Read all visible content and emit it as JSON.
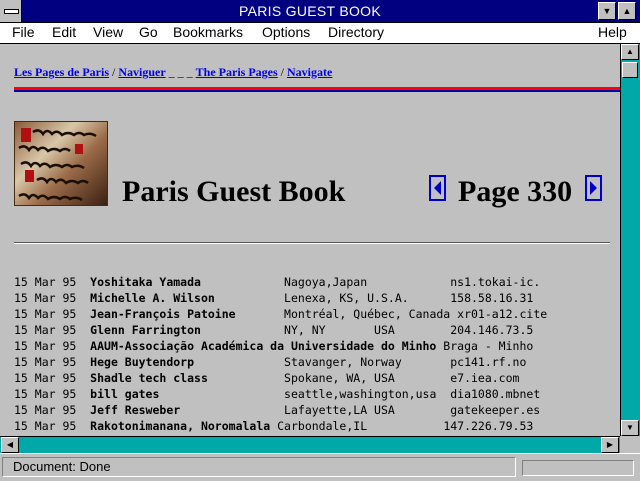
{
  "window": {
    "title": "PARIS GUEST BOOK"
  },
  "menu": [
    "File",
    "Edit",
    "View",
    "Go",
    "Bookmarks",
    "Options",
    "Directory",
    "Help"
  ],
  "breadcrumb": {
    "link1": "Les Pages de Paris",
    "sep1": " / ",
    "link2": "Naviguer",
    "sep2": " _ _ _ ",
    "link3": "The Paris Pages",
    "sep3": " / ",
    "link4": "Navigate"
  },
  "heading": {
    "title": "Paris Guest Book",
    "page": "Page 330"
  },
  "icons": {
    "prev": "left-arrow-icon",
    "next": "right-arrow-icon",
    "logo": "manuscript-logo",
    "scroll_up": "up-arrow-icon",
    "scroll_down": "down-arrow-icon",
    "scroll_left": "left-arrow-icon",
    "scroll_right": "right-arrow-icon"
  },
  "entries": [
    {
      "date": "15 Mar 95",
      "name": "Yoshitaka Yamada",
      "location": "Nagoya,Japan",
      "host": "ns1.tokai-ic."
    },
    {
      "date": "15 Mar 95",
      "name": "Michelle A. Wilson",
      "location": "Lenexa, KS, U.S.A.",
      "host": "158.58.16.31"
    },
    {
      "date": "15 Mar 95",
      "name": "Jean-François Patoine",
      "location": "Montréal, Québec, Canada",
      "host": "xr01-a12.cite"
    },
    {
      "date": "15 Mar 95",
      "name": "Glenn Farrington",
      "location": "NY, NY       USA",
      "host": "204.146.73.5"
    },
    {
      "date": "15 Mar 95",
      "name": "AAUM-Associação Académica da Universidade do Minho",
      "location": "Braga - Minho",
      "host": ""
    },
    {
      "date": "15 Mar 95",
      "name": "Hege Buytendorp",
      "location": "Stavanger, Norway",
      "host": "pc141.rf.no"
    },
    {
      "date": "15 Mar 95",
      "name": "Shadle tech class",
      "location": "Spokane, WA, USA",
      "host": "e7.iea.com"
    },
    {
      "date": "15 Mar 95",
      "name": "bill gates",
      "location": "seattle,washington,usa",
      "host": "dia1080.mbnet"
    },
    {
      "date": "15 Mar 95",
      "name": "Jeff Resweber",
      "location": "Lafayette,LA USA",
      "host": "gatekeeper.es"
    },
    {
      "date": "15 Mar 95",
      "name": "Rakotonimanana, Noromalala",
      "location": "Carbondale,IL",
      "host": "147.226.79.53"
    }
  ],
  "status": {
    "text": "Document: Done"
  }
}
